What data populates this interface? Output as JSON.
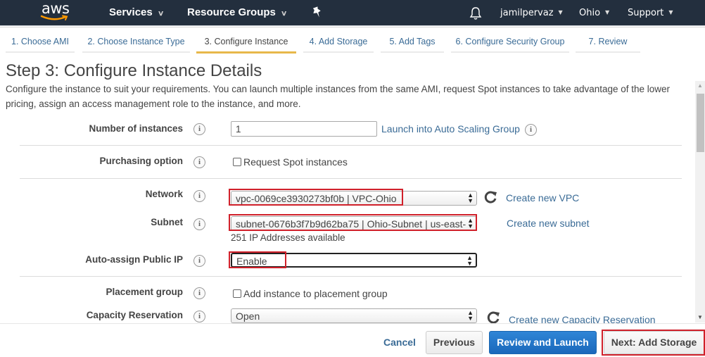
{
  "topnav": {
    "logo": "aws",
    "services": "Services",
    "resource_groups": "Resource Groups",
    "pin_icon": "pin-icon",
    "bell_icon": "bell-icon",
    "user": "jamilpervaz",
    "region": "Ohio",
    "support": "Support",
    "brand_color": "#232f3e",
    "logo_smile_color": "#ff9900"
  },
  "wizard": {
    "tabs": [
      {
        "label": "1. Choose AMI",
        "active": false
      },
      {
        "label": "2. Choose Instance Type",
        "active": false
      },
      {
        "label": "3. Configure Instance",
        "active": true
      },
      {
        "label": "4. Add Storage",
        "active": false
      },
      {
        "label": "5. Add Tags",
        "active": false
      },
      {
        "label": "6. Configure Security Group",
        "active": false
      },
      {
        "label": "7. Review",
        "active": false
      }
    ],
    "active_color": "#e7b84a"
  },
  "page": {
    "title": "Step 3: Configure Instance Details",
    "description": "Configure the instance to suit your requirements. You can launch multiple instances from the same AMI, request Spot instances to take advantage of the lower pricing, assign an access management role to the instance, and more."
  },
  "form": {
    "number_of_instances": {
      "label": "Number of instances",
      "value": "1",
      "link": "Launch into Auto Scaling Group"
    },
    "purchasing_option": {
      "label": "Purchasing option",
      "checkbox_label": "Request Spot instances",
      "checked": false
    },
    "network": {
      "label": "Network",
      "value": "vpc-0069ce3930273bf0b | VPC-Ohio",
      "link": "Create new VPC"
    },
    "subnet": {
      "label": "Subnet",
      "value": "subnet-0676b3f7b9d62ba75 | Ohio-Subnet | us-east-",
      "helper": "251 IP Addresses available",
      "link": "Create new subnet"
    },
    "auto_assign_ip": {
      "label": "Auto-assign Public IP",
      "value": "Enable"
    },
    "placement_group": {
      "label": "Placement group",
      "checkbox_label": "Add instance to placement group",
      "checked": false
    },
    "capacity_reservation": {
      "label": "Capacity Reservation",
      "value": "Open",
      "link": "Create new Capacity Reservation"
    },
    "info_glyph": "i",
    "highlight_color": "#d0202a"
  },
  "footer": {
    "cancel": "Cancel",
    "previous": "Previous",
    "review_and_launch": "Review and Launch",
    "next": "Next: Add Storage",
    "primary_color": "#1a68bb"
  }
}
